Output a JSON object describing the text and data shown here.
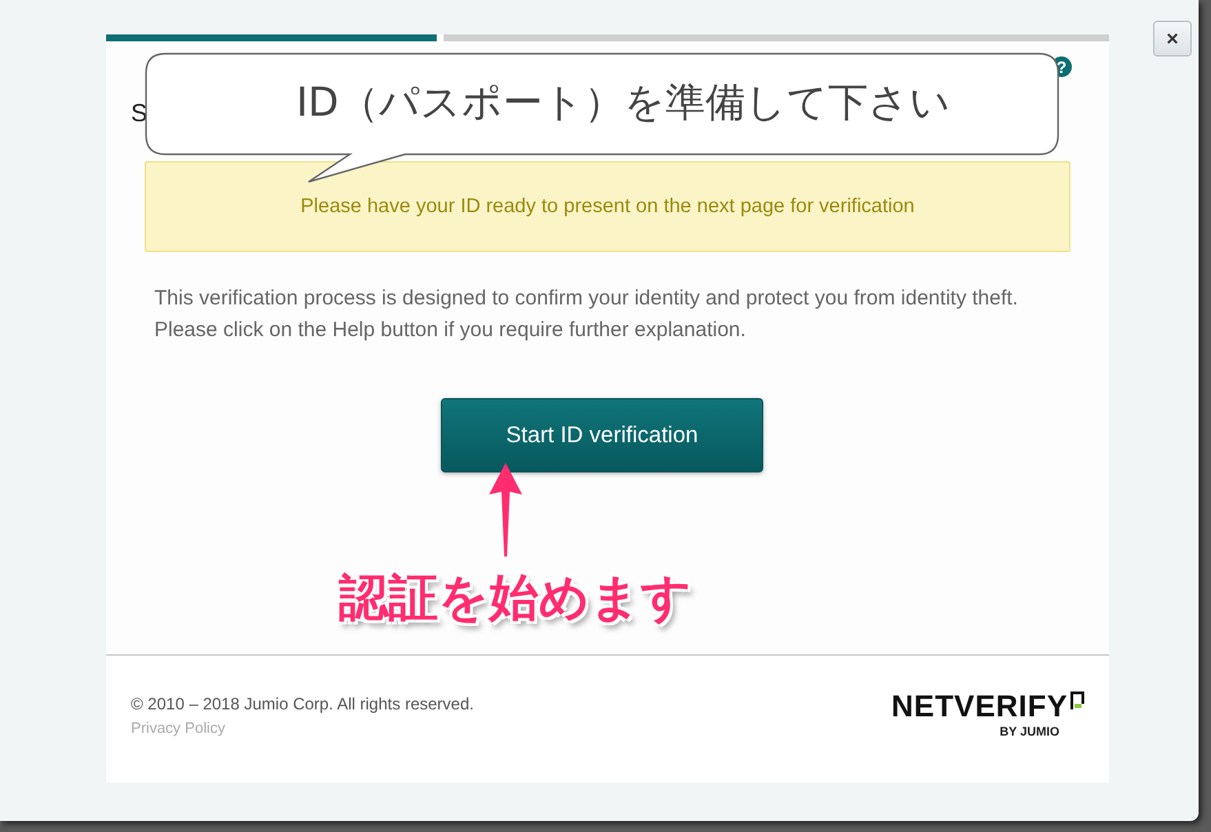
{
  "window": {
    "close_label": "×"
  },
  "progress": {
    "level": 0.33
  },
  "heading": "S",
  "help_label": "?",
  "notice": "Please have your ID ready to present on the next page for verification",
  "description": "This verification process is designed to confirm your identity and protect you from identity theft. Please click on the Help button if you require further explanation.",
  "start_button": "Start ID verification",
  "footer": {
    "copyright": "© 2010 – 2018 Jumio Corp. All rights reserved.",
    "privacy_link": "Privacy Policy",
    "logo": {
      "name": "NETVERIFY",
      "byline": "BY JUMIO"
    }
  },
  "annotations": [
    {
      "kind": "callout",
      "text": "ID（パスポート）を準備して下さい"
    },
    {
      "kind": "arrow_label",
      "text": "認証を始めます"
    }
  ]
}
